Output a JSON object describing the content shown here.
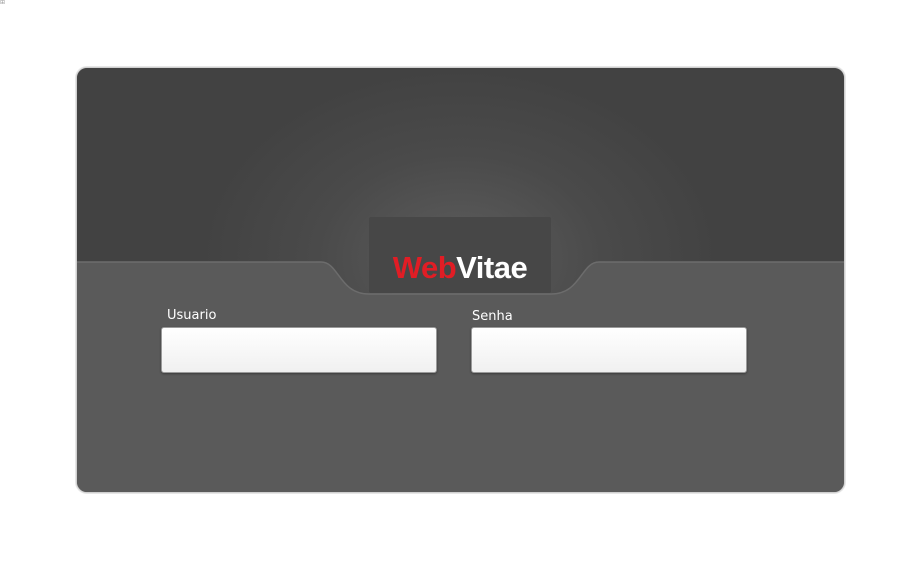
{
  "logo": {
    "part1": "Web",
    "part2": "Vitae",
    "part1_color": "#e11d25",
    "part2_color": "#ffffff"
  },
  "form": {
    "username_label": "Usuario",
    "username_value": "",
    "password_label": "Senha",
    "password_value": ""
  },
  "colors": {
    "panel_top": "#444444",
    "panel_bottom": "#5a5a5a",
    "page_background": "#ffffff"
  }
}
